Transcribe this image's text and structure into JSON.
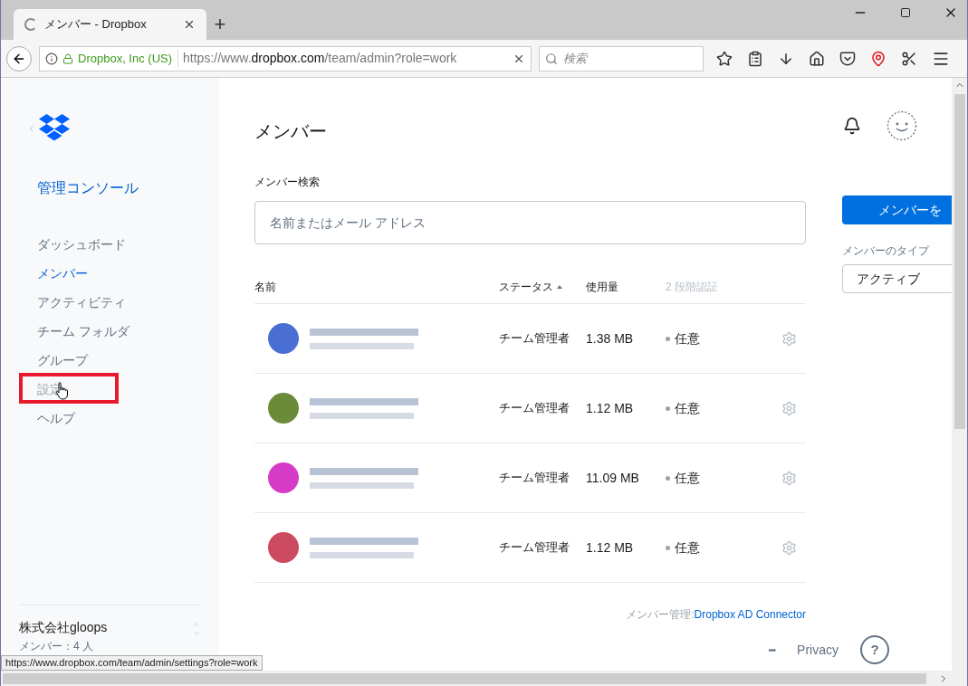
{
  "browser": {
    "tab_title": "メンバー - Dropbox",
    "new_tab": "+",
    "identity": "Dropbox, Inc (US)",
    "url_prefix": "https://www.",
    "url_domain": "dropbox.com",
    "url_path": "/team/admin?role=work",
    "search_placeholder": "検索"
  },
  "sidebar": {
    "console_title": "管理コンソール",
    "items": [
      {
        "label": "ダッシュボード",
        "selected": false,
        "highlighted": false
      },
      {
        "label": "メンバー",
        "selected": true,
        "highlighted": false
      },
      {
        "label": "アクティビティ",
        "selected": false,
        "highlighted": false
      },
      {
        "label": "チーム フォルダ",
        "selected": false,
        "highlighted": false
      },
      {
        "label": "グループ",
        "selected": false,
        "highlighted": false
      },
      {
        "label": "設定",
        "selected": false,
        "highlighted": true
      },
      {
        "label": "ヘルプ",
        "selected": false,
        "highlighted": false
      }
    ],
    "team_name": "株式会社gloops",
    "member_count": "メンバー：4 人"
  },
  "main": {
    "title": "メンバー",
    "search_label": "メンバー検索",
    "search_placeholder": "名前またはメール アドレス",
    "columns": [
      {
        "label": "名前",
        "sorted": false,
        "muted": false
      },
      {
        "label": "ステータス",
        "sorted": true,
        "muted": false
      },
      {
        "label": "使用量",
        "sorted": false,
        "muted": false
      },
      {
        "label": "2 段階認証",
        "sorted": false,
        "muted": true
      }
    ],
    "rows": [
      {
        "color": "#4a6fd4",
        "status": "チーム管理者",
        "usage": "1.38 MB",
        "two_factor": "任意"
      },
      {
        "color": "#6b8a3a",
        "status": "チーム管理者",
        "usage": "1.12 MB",
        "two_factor": "任意"
      },
      {
        "color": "#d63bc8",
        "status": "チーム管理者",
        "usage": "11.09 MB",
        "two_factor": "任意"
      },
      {
        "color": "#cc4a5f",
        "status": "チーム管理者",
        "usage": "1.12 MB",
        "two_factor": "任意"
      }
    ],
    "footer_note": "メンバー管理: ",
    "footer_link": "Dropbox AD Connector",
    "more": "•••",
    "privacy": "Privacy",
    "help": "?"
  },
  "right_panel": {
    "invite_button": "メンバーを",
    "type_label": "メンバーのタイプ",
    "type_value": "アクティブ"
  },
  "status_url": "https://www.dropbox.com/team/admin/settings?role=work"
}
